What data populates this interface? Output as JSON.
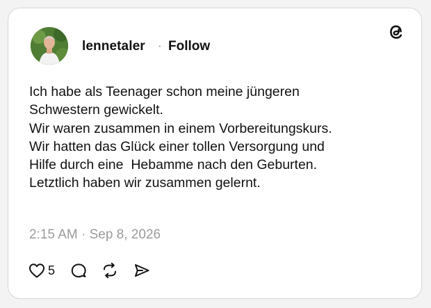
{
  "post": {
    "username": "lennetaler",
    "separator": "·",
    "follow_label": "Follow",
    "text_lines": [
      "Ich habe als Teenager schon meine jüngeren",
      "Schwestern gewickelt.",
      "Wir waren zusammen in einem Vorbereitungskurs.",
      "Wir hatten das Glück einer tollen Versorgung und",
      "Hilfe durch eine  Hebamme nach den Geburten.",
      "Letztlich haben wir zusammen gelernt."
    ],
    "timestamp": "2:15 AM · Sep 8, 2026",
    "like_count": "5"
  },
  "icons": {
    "brand": "threads-logo-icon",
    "like": "heart-icon",
    "reply": "comment-bubble-icon",
    "repost": "repost-icon",
    "share": "send-icon"
  },
  "colors": {
    "text": "#111111",
    "muted": "#9b9b9b",
    "card_border": "#d6d6d6",
    "background": "#f3f3f3"
  }
}
